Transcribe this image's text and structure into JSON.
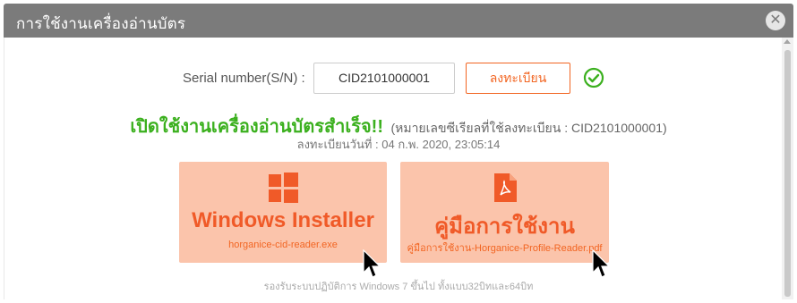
{
  "dialog": {
    "title": "การใช้งานเครื่องอ่านบัตร",
    "close_symbol": "✕"
  },
  "serial": {
    "label": "Serial number(S/N) :",
    "value": "CID2101000001",
    "register_label": "ลงทะเบียน",
    "status_icon": "check-circle-icon"
  },
  "status": {
    "success_title": "เปิดใช้งานเครื่องอ่านบัตรสำเร็จ!!",
    "success_note": "(หมายเลขซีเรียลที่ใช้ลงทะเบียน : CID2101000001)",
    "registered_at": "ลงทะเบียนวันที่ : 04 ก.พ. 2020, 23:05:14"
  },
  "downloads": [
    {
      "title": "Windows Installer",
      "file": "horganice-cid-reader.exe",
      "icon": "windows-icon"
    },
    {
      "title": "คู่มือการใช้งาน",
      "file": "คู่มือการใช้งาน-Horganice-Profile-Reader.pdf",
      "icon": "pdf-file-icon"
    }
  ],
  "os_note": "รองรับระบบปฏิบัติการ Windows 7 ขึ้นไป ทั้งแบบ32บิทและ64บิท",
  "colors": {
    "accent": "#f26522",
    "card_bg": "#fbc4ab",
    "success": "#3bb01e",
    "titlebar": "#7b7b7b"
  }
}
